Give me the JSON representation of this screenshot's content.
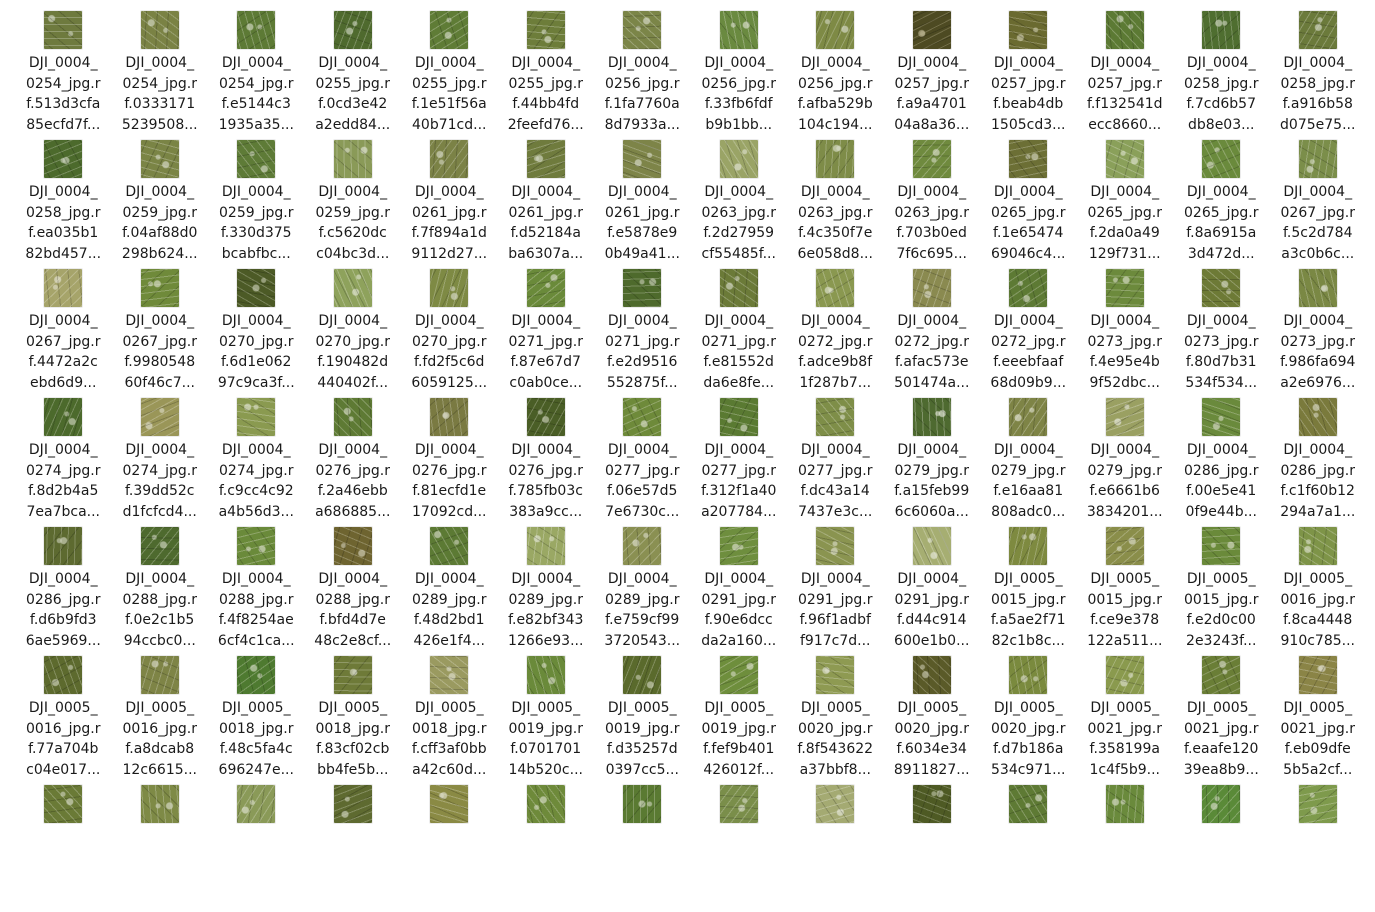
{
  "files": [
    {
      "line1": "DJI_0004_",
      "line2": "0254_jpg.r",
      "line3": "f.513d3cfa",
      "line4": "85ecfd7f...",
      "base": "#6e7a3e",
      "accent": "#d7dccb"
    },
    {
      "line1": "DJI_0004_",
      "line2": "0254_jpg.r",
      "line3": "f.0333171",
      "line4": "5239508...",
      "base": "#7a8244",
      "accent": "#d4d8c4"
    },
    {
      "line1": "DJI_0004_",
      "line2": "0254_jpg.r",
      "line3": "f.e5144c3",
      "line4": "1935a35...",
      "base": "#5d7a35",
      "accent": "#d2d8c4"
    },
    {
      "line1": "DJI_0004_",
      "line2": "0255_jpg.r",
      "line3": "f.0cd3e42",
      "line4": "a2edd84...",
      "base": "#4f6a2e",
      "accent": "#cfd5c2"
    },
    {
      "line1": "DJI_0004_",
      "line2": "0255_jpg.r",
      "line3": "f.1e51f56a",
      "line4": "40b71cd...",
      "base": "#5f7c36",
      "accent": "#d6dbc8"
    },
    {
      "line1": "DJI_0004_",
      "line2": "0255_jpg.r",
      "line3": "f.44bb4fd",
      "line4": "2feefd76...",
      "base": "#6d7d3a",
      "accent": "#dadfcc"
    },
    {
      "line1": "DJI_0004_",
      "line2": "0256_jpg.r",
      "line3": "f.1fa7760a",
      "line4": "8d7933a...",
      "base": "#7b8548",
      "accent": "#d9dccb"
    },
    {
      "line1": "DJI_0004_",
      "line2": "0256_jpg.r",
      "line3": "f.33fb6fdf",
      "line4": "b9b1bb...",
      "base": "#6a8a40",
      "accent": "#dde1d0"
    },
    {
      "line1": "DJI_0004_",
      "line2": "0256_jpg.r",
      "line3": "f.afba529b",
      "line4": "104c194...",
      "base": "#7e8a45",
      "accent": "#d8dccb"
    },
    {
      "line1": "DJI_0004_",
      "line2": "0257_jpg.r",
      "line3": "f.a9a4701",
      "line4": "04a8a36...",
      "base": "#4d4a22",
      "accent": "#b9b28e"
    },
    {
      "line1": "DJI_0004_",
      "line2": "0257_jpg.r",
      "line3": "f.beab4db",
      "line4": "1505cd3...",
      "base": "#6a6a30",
      "accent": "#cfcdb0"
    },
    {
      "line1": "DJI_0004_",
      "line2": "0257_jpg.r",
      "line3": "f.f132541d",
      "line4": "ecc8660...",
      "base": "#5c7a34",
      "accent": "#d3d9c4"
    },
    {
      "line1": "DJI_0004_",
      "line2": "0258_jpg.r",
      "line3": "f.7cd6b57",
      "line4": "db8e03...",
      "base": "#4f6e30",
      "accent": "#d0d6c2"
    },
    {
      "line1": "DJI_0004_",
      "line2": "0258_jpg.r",
      "line3": "f.a916b58",
      "line4": "d075e75...",
      "base": "#6b7a3b",
      "accent": "#d6dac8"
    },
    {
      "line1": "DJI_0004_",
      "line2": "0258_jpg.r",
      "line3": "f.ea035b1",
      "line4": "82bd457...",
      "base": "#4c6a2c",
      "accent": "#cbd2bd"
    },
    {
      "line1": "DJI_0004_",
      "line2": "0259_jpg.r",
      "line3": "f.04af88d0",
      "line4": "298b624...",
      "base": "#7a8445",
      "accent": "#d8dbc9"
    },
    {
      "line1": "DJI_0004_",
      "line2": "0259_jpg.r",
      "line3": "f.330d375",
      "line4": "bcabfbc...",
      "base": "#5e7b37",
      "accent": "#d4d9c6"
    },
    {
      "line1": "DJI_0004_",
      "line2": "0259_jpg.r",
      "line3": "f.c5620dc",
      "line4": "c04bc3d...",
      "base": "#8a9a58",
      "accent": "#e1e4d4"
    },
    {
      "line1": "DJI_0004_",
      "line2": "0261_jpg.r",
      "line3": "f.7f894a1d",
      "line4": "9112d27...",
      "base": "#7b8246",
      "accent": "#d6d8c6"
    },
    {
      "line1": "DJI_0004_",
      "line2": "0261_jpg.r",
      "line3": "f.d52184a",
      "line4": "ba6307a...",
      "base": "#6f7b3d",
      "accent": "#d5d9c7"
    },
    {
      "line1": "DJI_0004_",
      "line2": "0261_jpg.r",
      "line3": "f.e5878e9",
      "line4": "0b49a41...",
      "base": "#7d8448",
      "accent": "#d8dbc9"
    },
    {
      "line1": "DJI_0004_",
      "line2": "0263_jpg.r",
      "line3": "f.2d27959",
      "line4": "cf55485f...",
      "base": "#9aa466",
      "accent": "#e3e5d6"
    },
    {
      "line1": "DJI_0004_",
      "line2": "0263_jpg.r",
      "line3": "f.4c350f7e",
      "line4": "6e058d8...",
      "base": "#7e8c48",
      "accent": "#dadecb"
    },
    {
      "line1": "DJI_0004_",
      "line2": "0263_jpg.r",
      "line3": "f.703b0ed",
      "line4": "7f6c695...",
      "base": "#6f8a3e",
      "accent": "#d9ddca"
    },
    {
      "line1": "DJI_0004_",
      "line2": "0265_jpg.r",
      "line3": "f.1e65474",
      "line4": "69046c4...",
      "base": "#6c6f35",
      "accent": "#d2d3bd"
    },
    {
      "line1": "DJI_0004_",
      "line2": "0265_jpg.r",
      "line3": "f.2da0a49",
      "line4": "129f731...",
      "base": "#8aa05a",
      "accent": "#e0e4d2"
    },
    {
      "line1": "DJI_0004_",
      "line2": "0265_jpg.r",
      "line3": "f.8a6915a",
      "line4": "3d472d...",
      "base": "#6a8a3c",
      "accent": "#d8dcc9"
    },
    {
      "line1": "DJI_0004_",
      "line2": "0267_jpg.r",
      "line3": "f.5c2d784",
      "line4": "a3c0b6c...",
      "base": "#7b8e4a",
      "accent": "#dadecc"
    },
    {
      "line1": "DJI_0004_",
      "line2": "0267_jpg.r",
      "line3": "f.4472a2c",
      "line4": "ebd6d9...",
      "base": "#a6a46a",
      "accent": "#e4e2d2"
    },
    {
      "line1": "DJI_0004_",
      "line2": "0267_jpg.r",
      "line3": "f.9980548",
      "line4": "60f46c7...",
      "base": "#6f8a3a",
      "accent": "#d9ddc9"
    },
    {
      "line1": "DJI_0004_",
      "line2": "0270_jpg.r",
      "line3": "f.6d1e062",
      "line4": "97c9ca3f...",
      "base": "#4c5a26",
      "accent": "#c7ccb3"
    },
    {
      "line1": "DJI_0004_",
      "line2": "0270_jpg.r",
      "line3": "f.190482d",
      "line4": "440402f...",
      "base": "#8ea25c",
      "accent": "#e1e5d3"
    },
    {
      "line1": "DJI_0004_",
      "line2": "0270_jpg.r",
      "line3": "f.fd2f5c6d",
      "line4": "6059125...",
      "base": "#7e8a44",
      "accent": "#d8dbc8"
    },
    {
      "line1": "DJI_0004_",
      "line2": "0271_jpg.r",
      "line3": "f.87e67d7",
      "line4": "c0ab0ce...",
      "base": "#6a8a3a",
      "accent": "#d8dcc8"
    },
    {
      "line1": "DJI_0004_",
      "line2": "0271_jpg.r",
      "line3": "f.e2d9516",
      "line4": "552875f...",
      "base": "#4e6a2c",
      "accent": "#ccd2bc"
    },
    {
      "line1": "DJI_0004_",
      "line2": "0271_jpg.r",
      "line3": "f.e81552d",
      "line4": "da6e8fe...",
      "base": "#6b7a38",
      "accent": "#d4d8c5"
    },
    {
      "line1": "DJI_0004_",
      "line2": "0272_jpg.r",
      "line3": "f.adce9b8f",
      "line4": "1f287b7...",
      "base": "#8a9850",
      "accent": "#dfe2d0"
    },
    {
      "line1": "DJI_0004_",
      "line2": "0272_jpg.r",
      "line3": "f.afac573e",
      "line4": "501474a...",
      "base": "#8a8a50",
      "accent": "#dcdcc9"
    },
    {
      "line1": "DJI_0004_",
      "line2": "0272_jpg.r",
      "line3": "f.eeebfaaf",
      "line4": "68d09b9...",
      "base": "#5d7a34",
      "accent": "#d3d8c4"
    },
    {
      "line1": "DJI_0004_",
      "line2": "0273_jpg.r",
      "line3": "f.4e95e4b",
      "line4": "9f52dbc...",
      "base": "#6c8a3c",
      "accent": "#d9ddc9"
    },
    {
      "line1": "DJI_0004_",
      "line2": "0273_jpg.r",
      "line3": "f.80d7b31",
      "line4": "534f534...",
      "base": "#6d7a36",
      "accent": "#d5d8c5"
    },
    {
      "line1": "DJI_0004_",
      "line2": "0273_jpg.r",
      "line3": "f.986fa694",
      "line4": "a2e6976...",
      "base": "#7a8844",
      "accent": "#d8dbc9"
    },
    {
      "line1": "DJI_0004_",
      "line2": "0274_jpg.r",
      "line3": "f.8d2b4a5",
      "line4": "7ea7bca...",
      "base": "#4c6a2c",
      "accent": "#ccd2bc"
    },
    {
      "line1": "DJI_0004_",
      "line2": "0274_jpg.r",
      "line3": "f.39dd52c",
      "line4": "d1fcfcd4...",
      "base": "#9a9658",
      "accent": "#e0dfcd"
    },
    {
      "line1": "DJI_0004_",
      "line2": "0274_jpg.r",
      "line3": "f.c9cc4c92",
      "line4": "a4b56d3...",
      "base": "#8a9a50",
      "accent": "#dfe2cf"
    },
    {
      "line1": "DJI_0004_",
      "line2": "0276_jpg.r",
      "line3": "f.2a46ebb",
      "line4": "a686885...",
      "base": "#5e7a34",
      "accent": "#d3d8c4"
    },
    {
      "line1": "DJI_0004_",
      "line2": "0276_jpg.r",
      "line3": "f.81ecfd1e",
      "line4": "17092cd...",
      "base": "#7a7a42",
      "accent": "#d6d6c3"
    },
    {
      "line1": "DJI_0004_",
      "line2": "0276_jpg.r",
      "line3": "f.785fb03c",
      "line4": "383a9cc...",
      "base": "#4a5e26",
      "accent": "#c8cdb5"
    },
    {
      "line1": "DJI_0004_",
      "line2": "0277_jpg.r",
      "line3": "f.06e57d5",
      "line4": "7e6730c...",
      "base": "#6e8a3a",
      "accent": "#d9ddc9"
    },
    {
      "line1": "DJI_0004_",
      "line2": "0277_jpg.r",
      "line3": "f.312f1a40",
      "line4": "a207784...",
      "base": "#5a7a32",
      "accent": "#d2d8c3"
    },
    {
      "line1": "DJI_0004_",
      "line2": "0277_jpg.r",
      "line3": "f.dc43a14",
      "line4": "7437e3c...",
      "base": "#7e8e48",
      "accent": "#dadecb"
    },
    {
      "line1": "DJI_0004_",
      "line2": "0279_jpg.r",
      "line3": "f.a15feb99",
      "line4": "6c6060a...",
      "base": "#4e6a30",
      "accent": "#e6e8dc"
    },
    {
      "line1": "DJI_0004_",
      "line2": "0279_jpg.r",
      "line3": "f.e16aa81",
      "line4": "808adc0...",
      "base": "#7e8446",
      "accent": "#e3e4d6"
    },
    {
      "line1": "DJI_0004_",
      "line2": "0279_jpg.r",
      "line3": "f.e6661b6",
      "line4": "3834201...",
      "base": "#9aa062",
      "accent": "#e8e9de"
    },
    {
      "line1": "DJI_0004_",
      "line2": "0286_jpg.r",
      "line3": "f.00e5e41",
      "line4": "0f9e44b...",
      "base": "#6a8a3c",
      "accent": "#d8dcc9"
    },
    {
      "line1": "DJI_0004_",
      "line2": "0286_jpg.r",
      "line3": "f.c1f60b12",
      "line4": "294a7a1...",
      "base": "#7a7a3c",
      "accent": "#d6d6c2"
    },
    {
      "line1": "DJI_0004_",
      "line2": "0286_jpg.r",
      "line3": "f.d6b9fd3",
      "line4": "6ae5969...",
      "base": "#5d6a30",
      "accent": "#cfd3bd"
    },
    {
      "line1": "DJI_0004_",
      "line2": "0288_jpg.r",
      "line3": "f.0e2c1b5",
      "line4": "94ccbc0...",
      "base": "#4e6a2e",
      "accent": "#d0d6c1"
    },
    {
      "line1": "DJI_0004_",
      "line2": "0288_jpg.r",
      "line3": "f.4f8254ae",
      "line4": "6cf4c1ca...",
      "base": "#6a8a3a",
      "accent": "#d8dcc8"
    },
    {
      "line1": "DJI_0004_",
      "line2": "0288_jpg.r",
      "line3": "f.bfd4d7e",
      "line4": "48c2e8cf...",
      "base": "#6e6430",
      "accent": "#d2cfb8"
    },
    {
      "line1": "DJI_0004_",
      "line2": "0289_jpg.r",
      "line3": "f.48d2bd1",
      "line4": "426e1f4...",
      "base": "#5c7a34",
      "accent": "#d3d8c4"
    },
    {
      "line1": "DJI_0004_",
      "line2": "0289_jpg.r",
      "line3": "f.e82bf343",
      "line4": "1266e93...",
      "base": "#9aa864",
      "accent": "#e3e6d6"
    },
    {
      "line1": "DJI_0004_",
      "line2": "0289_jpg.r",
      "line3": "f.e759cf99",
      "line4": "3720543...",
      "base": "#8a9052",
      "accent": "#dfe0cf"
    },
    {
      "line1": "DJI_0004_",
      "line2": "0291_jpg.r",
      "line3": "f.90e6dcc",
      "line4": "da2a160...",
      "base": "#6e8e3e",
      "accent": "#dadeca"
    },
    {
      "line1": "DJI_0004_",
      "line2": "0291_jpg.r",
      "line3": "f.96f1adbf",
      "line4": "f917c7d...",
      "base": "#8a9450",
      "accent": "#dfe1cf"
    },
    {
      "line1": "DJI_0004_",
      "line2": "0291_jpg.r",
      "line3": "f.d44c914",
      "line4": "600e1b0...",
      "base": "#a6ae72",
      "accent": "#e6e8da"
    },
    {
      "line1": "DJI_0005_",
      "line2": "0015_jpg.r",
      "line3": "f.a5ae2f71",
      "line4": "82c1b8c...",
      "base": "#7e8a40",
      "accent": "#d8dbc7"
    },
    {
      "line1": "DJI_0005_",
      "line2": "0015_jpg.r",
      "line3": "f.ce9e378",
      "line4": "122a511...",
      "base": "#8a8e4a",
      "accent": "#dcddcb"
    },
    {
      "line1": "DJI_0005_",
      "line2": "0015_jpg.r",
      "line3": "f.e2d0c00",
      "line4": "2e3243f...",
      "base": "#6a8a3a",
      "accent": "#d8dcc8"
    },
    {
      "line1": "DJI_0005_",
      "line2": "0016_jpg.r",
      "line3": "f.8ca4448",
      "line4": "910c785...",
      "base": "#7e9448",
      "accent": "#dbdfcb"
    },
    {
      "line1": "DJI_0005_",
      "line2": "0016_jpg.r",
      "line3": "f.77a704b",
      "line4": "c04e017...",
      "base": "#5d6a2e",
      "accent": "#cfd3bd"
    },
    {
      "line1": "DJI_0005_",
      "line2": "0016_jpg.r",
      "line3": "f.a8dcab8",
      "line4": "12c6615...",
      "base": "#7e8446",
      "accent": "#d8d9c7"
    },
    {
      "line1": "DJI_0005_",
      "line2": "0018_jpg.r",
      "line3": "f.48c5fa4c",
      "line4": "696247e...",
      "base": "#4e7a30",
      "accent": "#d0d8c1"
    },
    {
      "line1": "DJI_0005_",
      "line2": "0018_jpg.r",
      "line3": "f.83cf02cb",
      "line4": "bb4fe5b...",
      "base": "#6e7a38",
      "accent": "#d4d7c4"
    },
    {
      "line1": "DJI_0005_",
      "line2": "0018_jpg.r",
      "line3": "f.cff3af0bb",
      "line4": "a42c60d...",
      "base": "#9a9a60",
      "accent": "#e0e0cf"
    },
    {
      "line1": "DJI_0005_",
      "line2": "0019_jpg.r",
      "line3": "f.0701701",
      "line4": "14b520c...",
      "base": "#6a8a3a",
      "accent": "#d8dcc8"
    },
    {
      "line1": "DJI_0005_",
      "line2": "0019_jpg.r",
      "line3": "f.d35257d",
      "line4": "0397cc5...",
      "base": "#5a6a2c",
      "accent": "#ced2bb"
    },
    {
      "line1": "DJI_0005_",
      "line2": "0019_jpg.r",
      "line3": "f.fef9b401",
      "line4": "426012f...",
      "base": "#6e8e3c",
      "accent": "#d9ddc9"
    },
    {
      "line1": "DJI_0005_",
      "line2": "0020_jpg.r",
      "line3": "f.8f543622",
      "line4": "a37bbf8...",
      "base": "#8e9a52",
      "accent": "#dfe1cf"
    },
    {
      "line1": "DJI_0005_",
      "line2": "0020_jpg.r",
      "line3": "f.6034e34",
      "line4": "8911827...",
      "base": "#5a5a28",
      "accent": "#c8c7ae"
    },
    {
      "line1": "DJI_0005_",
      "line2": "0020_jpg.r",
      "line3": "f.d7b186a",
      "line4": "534c971...",
      "base": "#7a8a3e",
      "accent": "#d7dac6"
    },
    {
      "line1": "DJI_0005_",
      "line2": "0021_jpg.r",
      "line3": "f.358199a",
      "line4": "1c4f5b9...",
      "base": "#8a9a4e",
      "accent": "#dee1ce"
    },
    {
      "line1": "DJI_0005_",
      "line2": "0021_jpg.r",
      "line3": "f.eaafe120",
      "line4": "39ea8b9...",
      "base": "#6a7e36",
      "accent": "#d4d8c4"
    },
    {
      "line1": "DJI_0005_",
      "line2": "0021_jpg.r",
      "line3": "f.eb09dfe",
      "line4": "5b5a2cf...",
      "base": "#8a8446",
      "accent": "#dcdac8"
    },
    {
      "line1": "",
      "line2": "",
      "line3": "",
      "line4": "",
      "base": "#6a7a36",
      "accent": "#d4d8c4"
    },
    {
      "line1": "",
      "line2": "",
      "line3": "",
      "line4": "",
      "base": "#7e8a46",
      "accent": "#d8dbc9"
    },
    {
      "line1": "",
      "line2": "",
      "line3": "",
      "line4": "",
      "base": "#8a9a58",
      "accent": "#dfe2d1"
    },
    {
      "line1": "",
      "line2": "",
      "line3": "",
      "line4": "",
      "base": "#5e6a30",
      "accent": "#cfd3bd"
    },
    {
      "line1": "",
      "line2": "",
      "line3": "",
      "line4": "",
      "base": "#8a8a44",
      "accent": "#dcdcc8"
    },
    {
      "line1": "",
      "line2": "",
      "line3": "",
      "line4": "",
      "base": "#6e8a3a",
      "accent": "#d9ddc9"
    },
    {
      "line1": "",
      "line2": "",
      "line3": "",
      "line4": "",
      "base": "#5a7a32",
      "accent": "#d2d8c3"
    },
    {
      "line1": "",
      "line2": "",
      "line3": "",
      "line4": "",
      "base": "#7a8e4a",
      "accent": "#dadecb"
    },
    {
      "line1": "",
      "line2": "",
      "line3": "",
      "line4": "",
      "base": "#a4aa72",
      "accent": "#e6e8da"
    },
    {
      "line1": "",
      "line2": "",
      "line3": "",
      "line4": "",
      "base": "#4e5a24",
      "accent": "#c6cbb2"
    },
    {
      "line1": "",
      "line2": "",
      "line3": "",
      "line4": "",
      "base": "#5e7a34",
      "accent": "#d3d8c4"
    },
    {
      "line1": "",
      "line2": "",
      "line3": "",
      "line4": "",
      "base": "#6a8a3c",
      "accent": "#d8dcc9"
    },
    {
      "line1": "",
      "line2": "",
      "line3": "",
      "line4": "",
      "base": "#5a8a38",
      "accent": "#d6dcc7"
    },
    {
      "line1": "",
      "line2": "",
      "line3": "",
      "line4": "",
      "base": "#7e9a4c",
      "accent": "#dce0cc"
    }
  ]
}
